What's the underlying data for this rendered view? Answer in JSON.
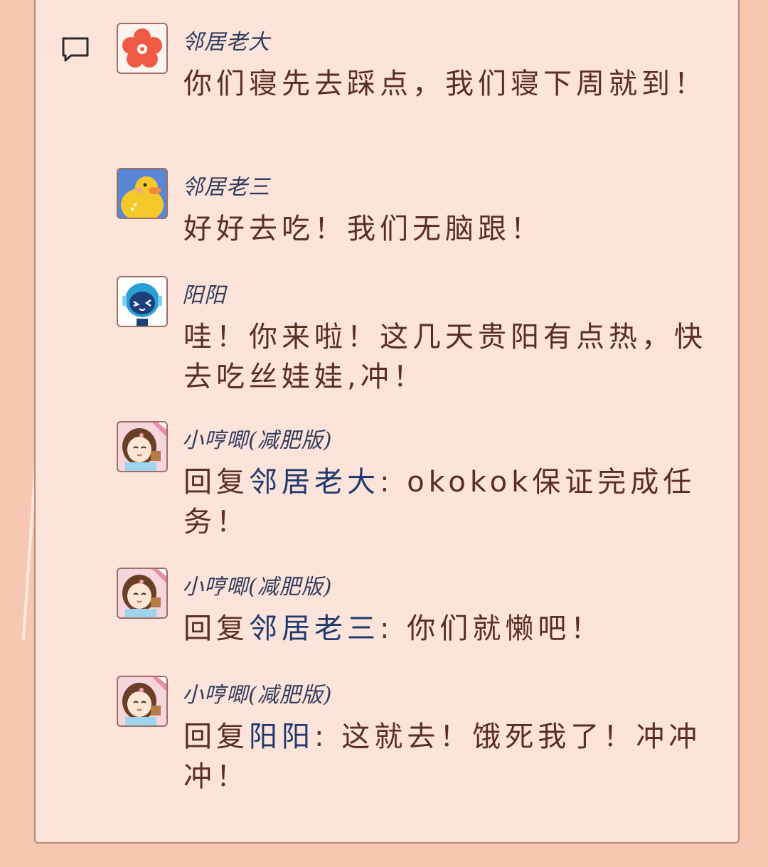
{
  "comments": [
    {
      "name": "邻居老大",
      "avatar": "flower-avatar",
      "text": "你们寝先去踩点，我们寝下周就到！"
    },
    {
      "name": "邻居老三",
      "avatar": "duck-avatar",
      "text": "好好去吃！我们无脑跟！"
    },
    {
      "name": "阳阳",
      "avatar": "astronaut-avatar",
      "text": "哇！你来啦！这几天贵阳有点热，快去吃丝娃娃,冲！"
    },
    {
      "name": "小哼唧(减肥版)",
      "avatar": "girl-avatar",
      "reply": {
        "prefix": "回复",
        "target": "邻居老大",
        "message": "okokok保证完成任务！"
      }
    },
    {
      "name": "小哼唧(减肥版)",
      "avatar": "girl-avatar",
      "reply": {
        "prefix": "回复",
        "target": "邻居老三",
        "message": "你们就懒吧！"
      }
    },
    {
      "name": "小哼唧(减肥版)",
      "avatar": "girl-avatar",
      "reply": {
        "prefix": "回复",
        "target": "阳阳",
        "message": "这就去！饿死我了！冲冲冲！"
      }
    }
  ],
  "colors": {
    "background": "#f8c7b2",
    "panel": "#fde4da",
    "name": "#2f3c5c",
    "text": "#5a2e22",
    "reply_target": "#1f3a6e"
  },
  "reply_colon": ": "
}
